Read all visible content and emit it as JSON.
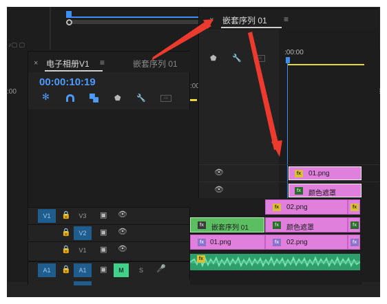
{
  "top_window": {
    "close_glyph": "×",
    "title": "嵌套序列 01",
    "menu_glyph": "≡",
    "ruler_time": ":00:00",
    "clips": [
      {
        "fx": "fx",
        "label": "01.png"
      },
      {
        "fx": "fx",
        "label": "颜色遮罩"
      }
    ]
  },
  "bg_ruler": {
    "left_label": ":00",
    "mid_label": ":00",
    "right_label": "2"
  },
  "main_window": {
    "close_glyph": "×",
    "active_tab": "电子相册V1",
    "menu_glyph": "≡",
    "inactive_tab": "嵌套序列 01",
    "timecode": "00:00:10:19",
    "tools": [
      "snap-icon",
      "magnet-icon",
      "linked-selection-icon",
      "marker-icon",
      "wrench-icon",
      "captions-icon"
    ],
    "tracks": [
      {
        "patch": "V1",
        "lock": "lock",
        "name": "V3"
      },
      {
        "patch": "",
        "lock": "lock",
        "name": "V2"
      },
      {
        "patch": "",
        "lock": "lock",
        "name": "V1"
      },
      {
        "patch": "A1",
        "lock": "lock",
        "name": "A1",
        "mute": "M",
        "solo": "S"
      }
    ],
    "timeline_clips": [
      {
        "fx": "fx",
        "label": "02.png"
      },
      {
        "fx": "fx",
        "label": "嵌套序列 01"
      },
      {
        "fx": "fx",
        "label": "颜色遮罩"
      },
      {
        "fx": "fx",
        "label": "01.png"
      },
      {
        "fx": "fx",
        "label": "02.png"
      },
      {
        "fx": "fx",
        "label": ""
      }
    ]
  },
  "colors": {
    "timecode": "#4d9bff",
    "track_patch": "#1f5d8e",
    "clip_pink": "#e07fdc",
    "clip_green": "#5bbf62",
    "audio_green": "#2e9e6a",
    "playhead": "#4d9bff",
    "work_area": "#e6d83a",
    "arrow_red": "#ec3b2e"
  }
}
